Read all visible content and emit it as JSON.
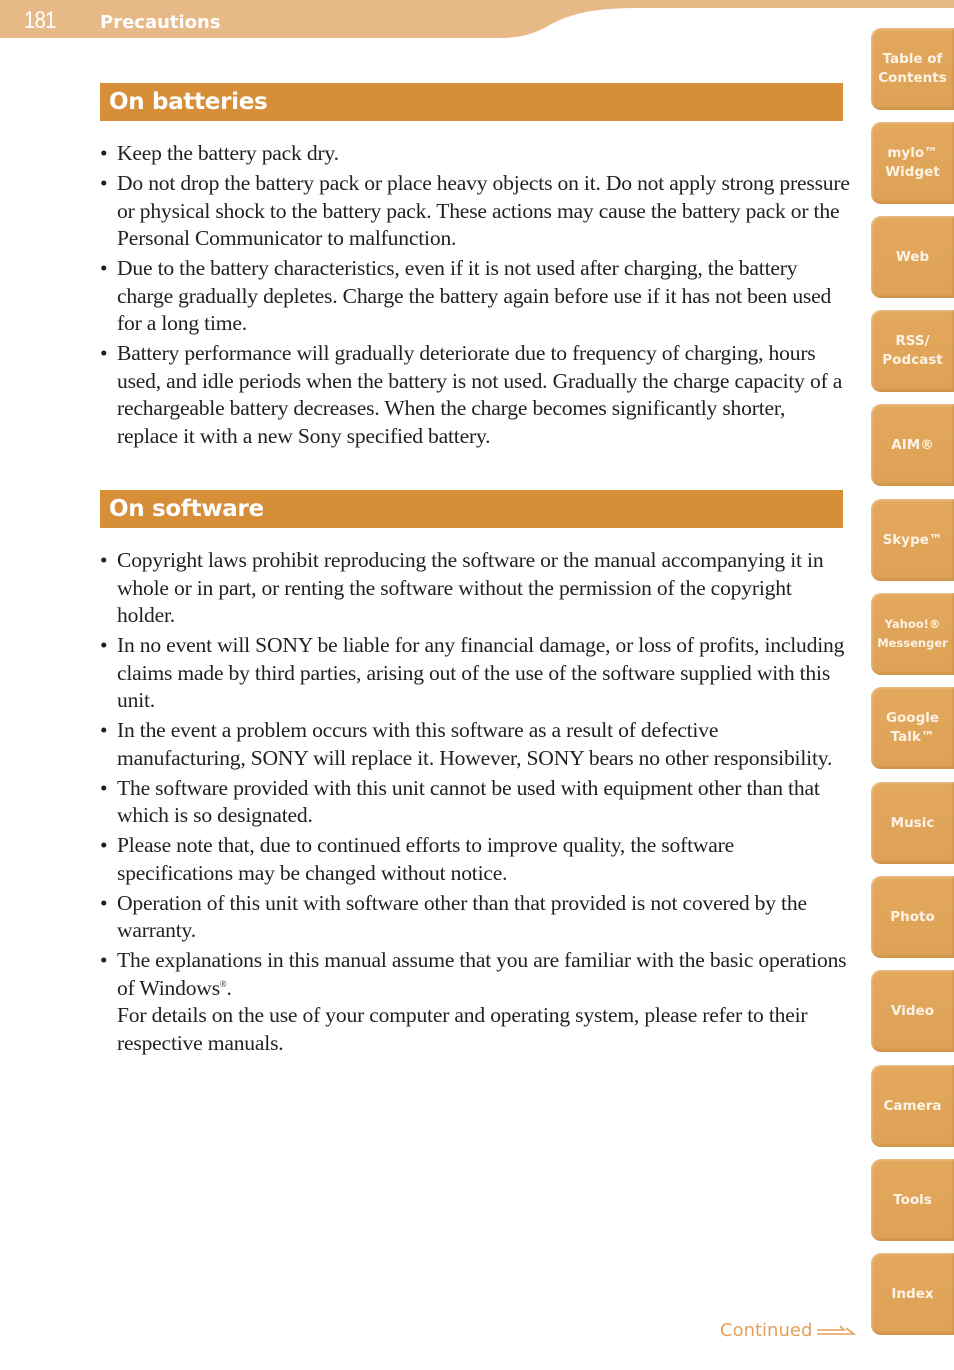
{
  "header": {
    "page_number": "181",
    "title": "Precautions"
  },
  "sections": [
    {
      "heading": "On batteries",
      "bullets": [
        "Keep the battery pack dry.",
        "Do not drop the battery pack or place heavy objects on it. Do not apply strong pressure or physical shock to the battery pack. These actions may cause the battery pack or the Personal Communicator to malfunction.",
        "Due to the battery characteristics, even if it is not used after charging, the battery charge gradually depletes. Charge the battery again before use if it has not been used for a long time.",
        "Battery performance will gradually deteriorate due to frequency of charging, hours used, and idle periods when the battery is not used. Gradually the charge capacity of a rechargeable battery decreases. When the charge becomes significantly shorter, replace it with a new Sony specified battery."
      ]
    },
    {
      "heading": "On software",
      "bullets": [
        "Copyright laws prohibit reproducing the software or the manual accompanying it in whole or in part, or renting the software without the permission of the copyright holder.",
        "In no event will SONY be liable for any financial damage, or loss of profits, including claims made by third parties, arising out of the use of the software supplied with this unit.",
        "In the event a problem occurs with this software as a result of defective manufacturing, SONY will replace it. However, SONY bears no other responsibility.",
        "The software provided with this unit cannot be used with equipment other than that which is so designated.",
        "Please note that, due to continued efforts to improve quality, the software specifications may be changed without notice.",
        "Operation of this unit with software other than that provided is not covered by the warranty."
      ],
      "last_bullet": {
        "text_before_mark": "The explanations in this manual assume that you are familiar with the basic operations of Windows",
        "registered_mark": "®",
        "text_after_mark": ".",
        "continuation": "For details on the use of your computer and operating system, please refer to their respective manuals."
      }
    }
  ],
  "bullet_glyph": "•",
  "side_tabs": [
    {
      "label": "Table of\nContents"
    },
    {
      "label": "mylo™\nWidget"
    },
    {
      "label": "Web"
    },
    {
      "label": "RSS/\nPodcast"
    },
    {
      "label": "AIM®"
    },
    {
      "label": "Skype™"
    },
    {
      "label": "Yahoo!®\nMessenger"
    },
    {
      "label": "Google\nTalk™"
    },
    {
      "label": "Music"
    },
    {
      "label": "Photo"
    },
    {
      "label": "Video"
    },
    {
      "label": "Camera"
    },
    {
      "label": "Tools"
    },
    {
      "label": "Index"
    }
  ],
  "footer": {
    "continued_label": "Continued"
  },
  "colors": {
    "header_band": "#e7b987",
    "section_bar": "#d68f38",
    "tab": "#dfa45a",
    "continued": "#e3a05a"
  }
}
